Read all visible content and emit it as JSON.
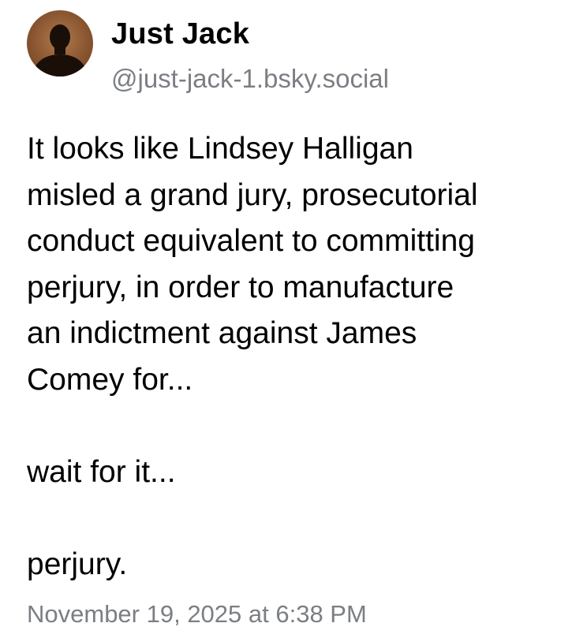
{
  "author": {
    "display_name": "Just Jack",
    "handle": "@just-jack-1.bsky.social",
    "avatar_icon": "user-silhouette-icon"
  },
  "post": {
    "text": "It looks like Lindsey Halligan\nmisled a grand jury, prosecutorial\nconduct equivalent to committing\nperjury, in order to manufacture\nan indictment against James\nComey for...\n\nwait for it...\n\nperjury.",
    "timestamp": "November 19, 2025 at 6:38 PM"
  },
  "colors": {
    "text": "#000000",
    "secondary_text": "#7b7e83",
    "background": "#ffffff"
  }
}
